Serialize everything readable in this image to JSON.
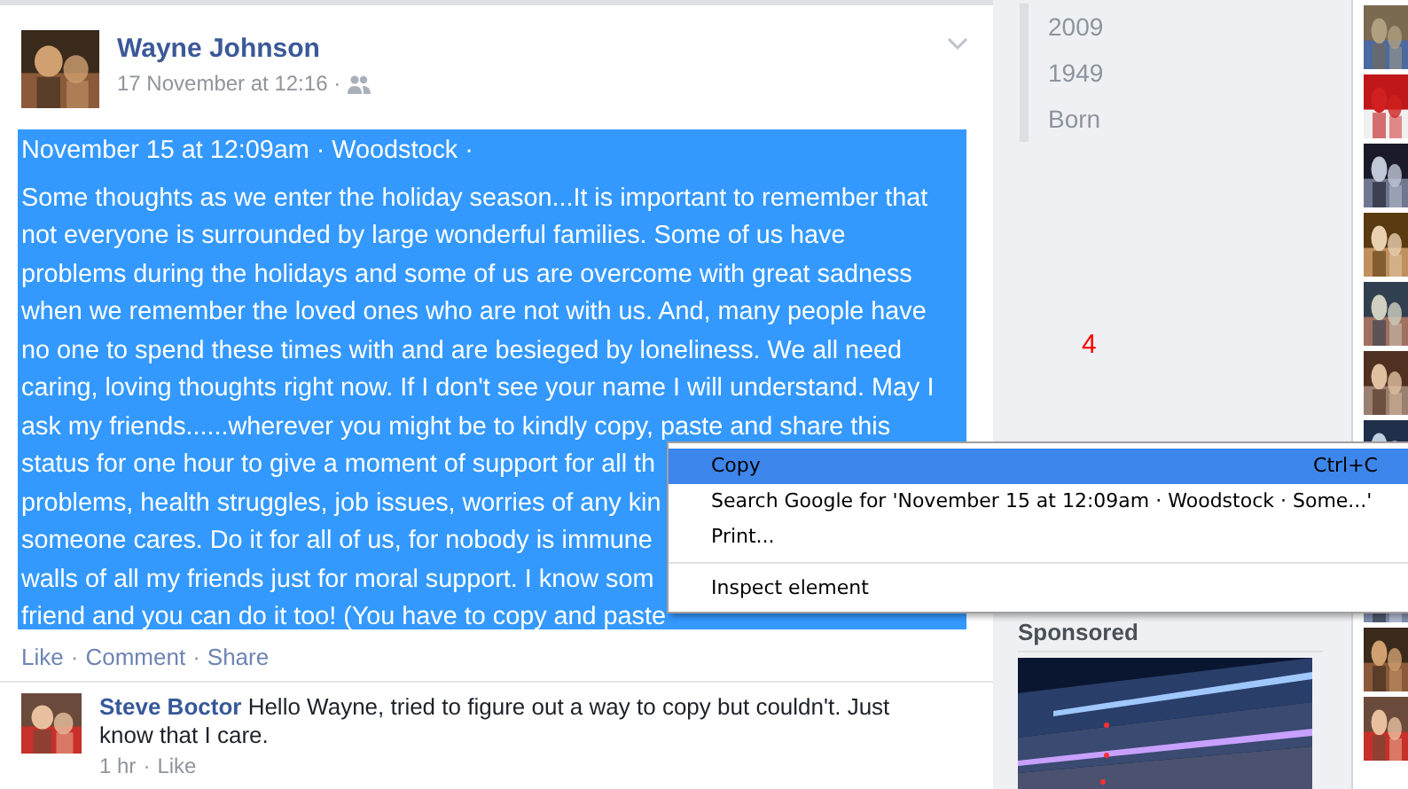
{
  "post": {
    "author": "Wayne Johnson",
    "timestamp": "17 November at 12:16 ·",
    "body": {
      "selected": true,
      "lines": [
        "November 15 at 12:09am · Woodstock ·",
        "Some thoughts as we enter the holiday season...It is important to remember that",
        "not everyone is surrounded by large wonderful families. Some of us have",
        "problems during the holidays and some of us are overcome with great sadness",
        "when we remember the loved ones who are not with us. And, many people have",
        "no one to spend these times with and are besieged by loneliness. We all need",
        "caring, loving thoughts right now. If I don't see your name I will understand. May I",
        "ask my friends......wherever you might be to kindly copy, paste and share this",
        "status for one hour to give a moment of support for all th",
        "problems, health struggles, job issues, worries of any kin",
        "someone cares. Do it for all of us, for nobody is immune",
        "walls of all my friends just for moral support. I know som",
        "friend and you can do it too! (You have to copy and paste"
      ]
    },
    "separator": "·",
    "actions": [
      "Like",
      "Comment",
      "Share"
    ],
    "comment": {
      "author": "Steve Boctor",
      "text": "Hello Wayne, tried to figure out a way to copy but couldn't. Just know that I care.",
      "time": "1 hr",
      "action": "Like"
    }
  },
  "sidebar": {
    "years": [
      "2009",
      "1949",
      "Born"
    ],
    "notification_count": "4",
    "sponsored_label": "Sponsored"
  },
  "context_menu": {
    "items": [
      {
        "kind": "item",
        "label": "Copy",
        "shortcut": "Ctrl+C",
        "selected": true
      },
      {
        "kind": "item",
        "label": "Search Google for 'November 15 at 12:09am · Woodstock · Some...'",
        "selected": false
      },
      {
        "kind": "item",
        "label": "Print...",
        "selected": false
      },
      {
        "kind": "separator"
      },
      {
        "kind": "item",
        "label": "Inspect element",
        "selected": false
      }
    ]
  }
}
